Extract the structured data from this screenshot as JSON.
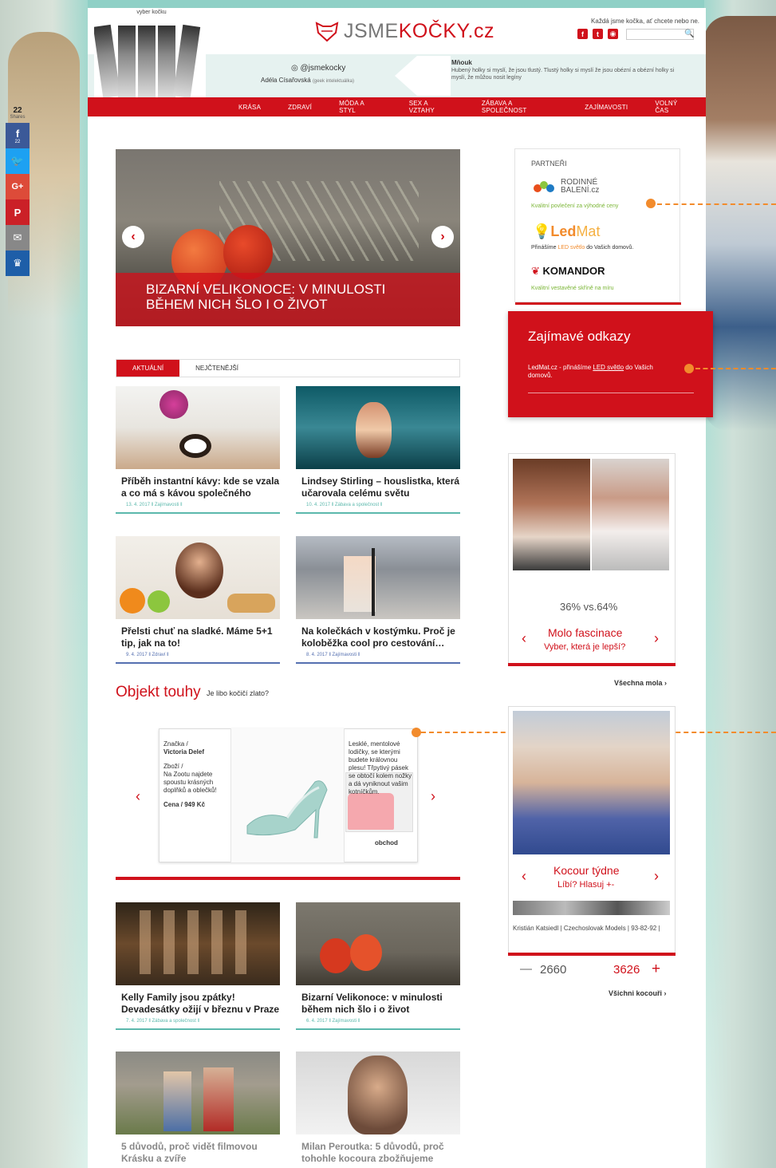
{
  "header": {
    "picker_label": "vyber kočku",
    "logo_prefix": "JSME",
    "logo_main": "KOČKY",
    "logo_suffix": ".cz",
    "tagline": "Každá jsme kočka, ať chcete nebo ne.",
    "instagram": "@jsmekocky",
    "author": "Adéla Císařovská",
    "author_note": "(geek intelektuálka)",
    "mnouk_title": "Mňouk",
    "mnouk_text": "Hubený holky si myslí, že jsou tlustý. Tlustý holky si myslí že jsou obézní a obézní holky si myslí, že můžou nosit legíny"
  },
  "nav": [
    "KRÁSA",
    "ZDRAVÍ",
    "MÓDA A STYL",
    "SEX A VZTAHY",
    "ZÁBAVA A SPOLEČNOST",
    "ZAJÍMAVOSTI",
    "VOLNÝ ČAS"
  ],
  "share": {
    "count": "22",
    "label": "Shares",
    "fb_count": "22"
  },
  "slider": {
    "caption": "BIZARNÍ VELIKONOCE: V MINULOSTI BĚHEM NICH ŠLO I O ŽIVOT"
  },
  "tabs": [
    "AKTUÁLNÍ",
    "NEJČTENĚJŠÍ"
  ],
  "articles": [
    {
      "title": "Příběh instantní kávy: kde se vzala a co má s kávou společného",
      "meta": "13. 4. 2017 ‖ Zajímavosti ‖"
    },
    {
      "title": "Lindsey Stirling – houslistka, která učarovala celému světu",
      "meta": "10. 4. 2017 ‖ Zábava a společnost ‖"
    },
    {
      "title": "Přelsti chuť na sladké. Máme 5+1 tip, jak na to!",
      "meta": "9. 4. 2017 ‖ Zdraví ‖"
    },
    {
      "title": "Na kolečkách v kostýmku. Proč je koloběžka cool pro cestování…",
      "meta": "8. 4. 2017 ‖ Zajímavosti ‖"
    },
    {
      "title": "Kelly Family jsou zpátky! Devadesátky ožijí v březnu v Praze",
      "meta": "7. 4. 2017 ‖ Zábava a společnost ‖"
    },
    {
      "title": "Bizarní Velikonoce: v minulosti během nich šlo i o život",
      "meta": "6. 4. 2017 ‖ Zajímavosti ‖"
    },
    {
      "title": "5 důvodů, proč vidět filmovou Krásku a zvíře",
      "meta": ""
    },
    {
      "title": "Milan Peroutka: 5 důvodů, proč tohohle kocoura zbožňujeme",
      "meta": ""
    }
  ],
  "objekt": {
    "title": "Objekt touhy",
    "subtitle": "Je libo kočičí zlato?",
    "brand_label": "Značka /",
    "brand": "Victoria Delef",
    "goods_label": "Zboží /",
    "goods": "Na Zootu najdete spoustu krásných doplňků a oblečků!",
    "price": "Cena / 949 Kč",
    "desc": "Lesklé, mentolové lodičky, se kterými budete královnou plesu! Třpytivý pásek se obtočí kolem nožky a dá vyniknout vašim kotníčkům.",
    "shop": "obchod"
  },
  "partners": {
    "title": "PARTNEŘI",
    "p1_logo": "RODINNÉ BALENÍ.cz",
    "p1_desc": "Kvalitní povlečení za výhodné ceny",
    "p2_logo_a": "Led",
    "p2_logo_b": "Mat",
    "p2_desc_a": "Přinášíme ",
    "p2_desc_b": "LED světlo",
    "p2_desc_c": " do Vašich domovů.",
    "p3_logo": "KOMANDOR",
    "p3_desc": "Kvalitní vestavěné skříně na míru"
  },
  "links": {
    "title": "Zajímavé odkazy",
    "text_a": "LedMat.cz - přinášíme ",
    "text_b": "LED světlo",
    "text_c": " do Vašich domovů."
  },
  "mola": {
    "pct": "36% vs.64%",
    "title": "Molo fascinace",
    "sub": "Vyber, která je lepší?",
    "more": "Všechna mola ›"
  },
  "kocour": {
    "title": "Kocour týdne",
    "sub": "Líbí? Hlasuj +-",
    "meta": "Kristián Katsiedl | Czechoslovak Models | 93-82-92 |",
    "minus": "—",
    "minus_count": "2660",
    "plus_count": "3626",
    "plus": "+",
    "more": "Všichni kocouři ›"
  },
  "colors": {
    "brand_red": "#d0111b",
    "accent_orange": "#f28b2c",
    "teal": "#5bb8ac"
  }
}
